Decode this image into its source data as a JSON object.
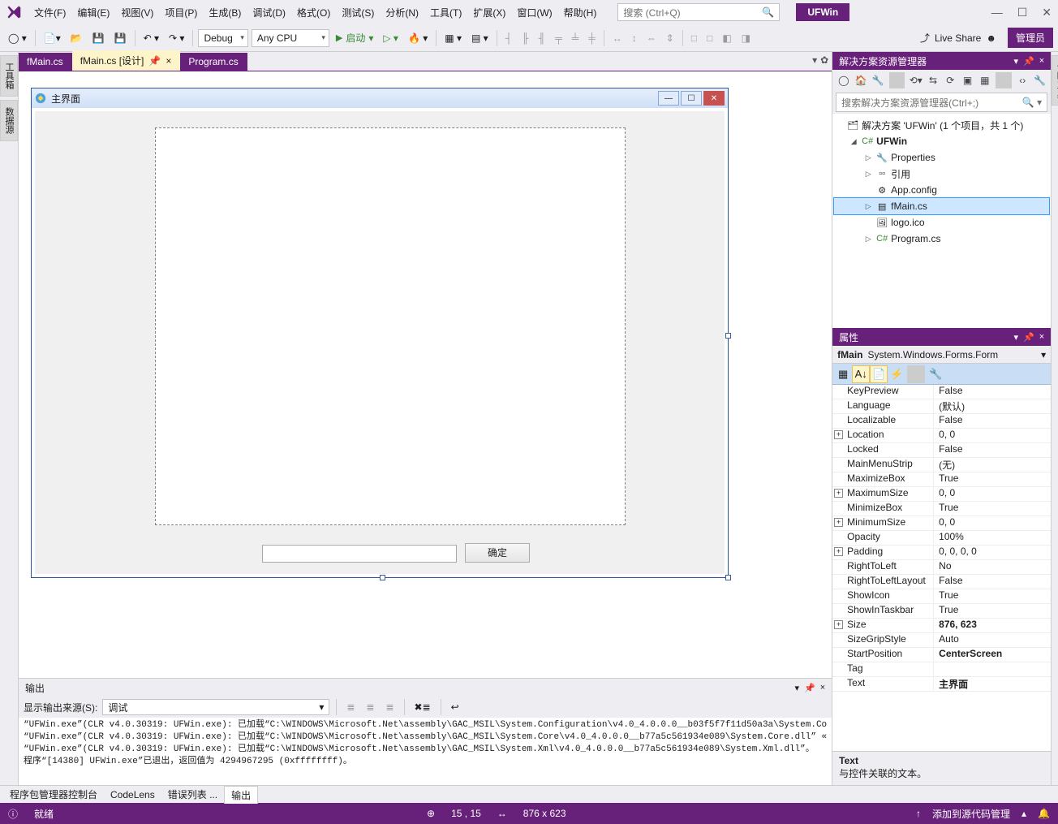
{
  "titlebar": {
    "menus": [
      "文件(F)",
      "编辑(E)",
      "视图(V)",
      "项目(P)",
      "生成(B)",
      "调试(D)",
      "格式(O)",
      "测试(S)",
      "分析(N)",
      "工具(T)",
      "扩展(X)",
      "窗口(W)",
      "帮助(H)"
    ],
    "search_placeholder": "搜索 (Ctrl+Q)",
    "app_name": "UFWin"
  },
  "toolbar": {
    "config": "Debug",
    "platform": "Any CPU",
    "start": "启动",
    "live_share": "Live Share",
    "admin": "管理员"
  },
  "left_tabs": [
    "工具箱",
    "数据源"
  ],
  "right_tab": "诊断工具",
  "doc_tabs": {
    "items": [
      {
        "label": "fMain.cs",
        "active": false
      },
      {
        "label": "fMain.cs [设计]",
        "active": true,
        "pinned": true
      },
      {
        "label": "Program.cs",
        "active": false
      }
    ]
  },
  "designer_form": {
    "caption": "主界面",
    "button_text": "确定"
  },
  "output": {
    "title": "输出",
    "src_label": "显示输出来源(S):",
    "src_value": "调试",
    "lines": [
      "“UFWin.exe”(CLR v4.0.30319: UFWin.exe): 已加载“C:\\WINDOWS\\Microsoft.Net\\assembly\\GAC_MSIL\\System.Configuration\\v4.0_4.0.0.0__b03f5f7f11d50a3a\\System.Co",
      "“UFWin.exe”(CLR v4.0.30319: UFWin.exe): 已加载“C:\\WINDOWS\\Microsoft.Net\\assembly\\GAC_MSIL\\System.Core\\v4.0_4.0.0.0__b77a5c561934e089\\System.Core.dll” «",
      "“UFWin.exe”(CLR v4.0.30319: UFWin.exe): 已加载“C:\\WINDOWS\\Microsoft.Net\\assembly\\GAC_MSIL\\System.Xml\\v4.0_4.0.0.0__b77a5c561934e089\\System.Xml.dll”。",
      "程序“[14380] UFWin.exe”已退出，返回值为 4294967295 (0xffffffff)。"
    ]
  },
  "bottom_tabs": [
    "程序包管理器控制台",
    "CodeLens",
    "错误列表 ...",
    "输出"
  ],
  "statusbar": {
    "ready": "就绪",
    "pos": "15 , 15",
    "size": "876 x 623",
    "src_ctrl": "添加到源代码管理"
  },
  "solution_explorer": {
    "title": "解决方案资源管理器",
    "search_placeholder": "搜索解决方案资源管理器(Ctrl+;)",
    "root": "解决方案 'UFWin' (1 个项目，共 1 个)",
    "project": "UFWin",
    "items": [
      "Properties",
      "引用",
      "App.config",
      "fMain.cs",
      "logo.ico",
      "Program.cs"
    ]
  },
  "properties": {
    "title": "属性",
    "obj_name": "fMain",
    "obj_type": "System.Windows.Forms.Form",
    "rows": [
      {
        "k": "KeyPreview",
        "v": "False"
      },
      {
        "k": "Language",
        "v": "(默认)"
      },
      {
        "k": "Localizable",
        "v": "False"
      },
      {
        "k": "Location",
        "v": "0, 0",
        "exp": true
      },
      {
        "k": "Locked",
        "v": "False"
      },
      {
        "k": "MainMenuStrip",
        "v": "(无)"
      },
      {
        "k": "MaximizeBox",
        "v": "True"
      },
      {
        "k": "MaximumSize",
        "v": "0, 0",
        "exp": true
      },
      {
        "k": "MinimizeBox",
        "v": "True"
      },
      {
        "k": "MinimumSize",
        "v": "0, 0",
        "exp": true
      },
      {
        "k": "Opacity",
        "v": "100%"
      },
      {
        "k": "Padding",
        "v": "0, 0, 0, 0",
        "exp": true
      },
      {
        "k": "RightToLeft",
        "v": "No"
      },
      {
        "k": "RightToLeftLayout",
        "v": "False"
      },
      {
        "k": "ShowIcon",
        "v": "True"
      },
      {
        "k": "ShowInTaskbar",
        "v": "True"
      },
      {
        "k": "Size",
        "v": "876, 623",
        "exp": true,
        "bold": true
      },
      {
        "k": "SizeGripStyle",
        "v": "Auto"
      },
      {
        "k": "StartPosition",
        "v": "CenterScreen",
        "bold": true
      },
      {
        "k": "Tag",
        "v": ""
      },
      {
        "k": "Text",
        "v": "主界面",
        "bold": true
      }
    ],
    "desc_name": "Text",
    "desc_text": "与控件关联的文本。"
  }
}
